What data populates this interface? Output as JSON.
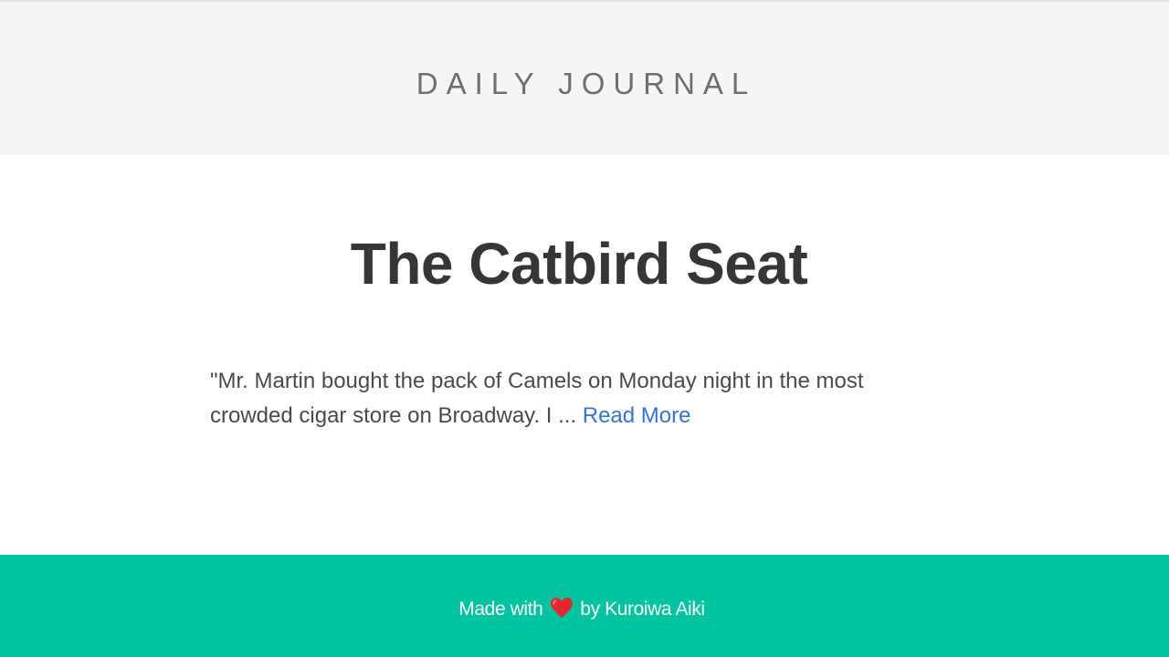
{
  "site": {
    "title": "DAILY JOURNAL"
  },
  "post": {
    "title": "The Catbird Seat",
    "excerpt": "\"Mr. Martin bought the pack of Camels on Monday night in the most crowded cigar store on Broadway. I ... ",
    "read_more_label": "Read More"
  },
  "footer": {
    "made_with_label": "Made with",
    "heart_icon": "heart-icon",
    "by_label": "by Kuroiwa Aiki",
    "background_color": "#00c4a0"
  },
  "colors": {
    "header_background": "#f5f5f5",
    "link": "#3273dc",
    "title_text": "#363636",
    "body_text": "#4a4a4a"
  }
}
